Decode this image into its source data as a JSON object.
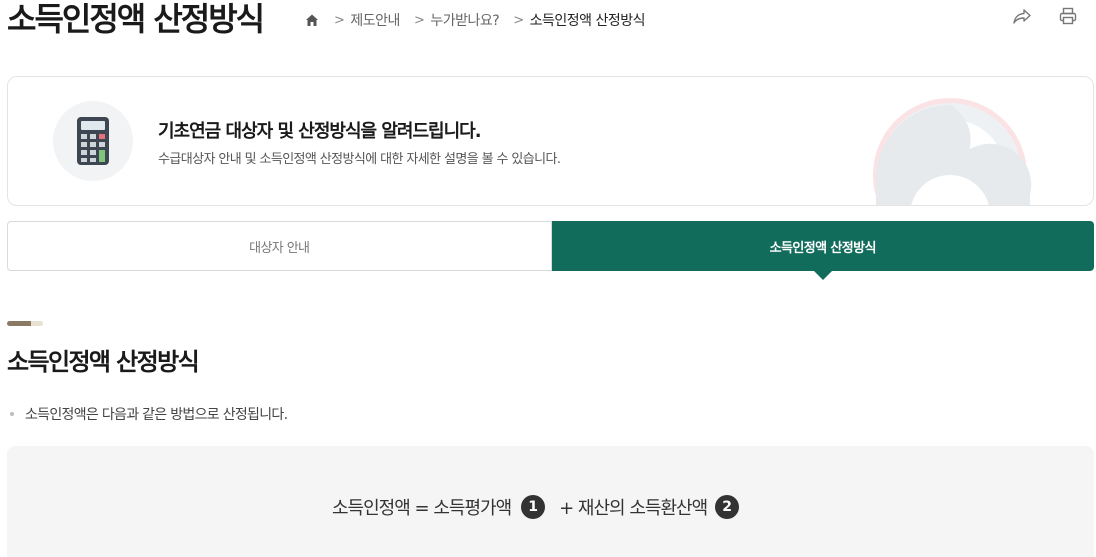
{
  "page_title": "소득인정액 산정방식",
  "breadcrumb": {
    "items": [
      "제도안내",
      "누가받나요?"
    ],
    "current": "소득인정액 산정방식"
  },
  "intro": {
    "title": "기초연금 대상자 및 산정방식을 알려드립니다.",
    "description": "수급대상자 안내 및 소득인정액 산정방식에 대한 자세한 설명을 볼 수 있습니다."
  },
  "tabs": [
    {
      "label": "대상자 안내",
      "active": false
    },
    {
      "label": "소득인정액 산정방식",
      "active": true
    }
  ],
  "section": {
    "title": "소득인정액 산정방식",
    "bullet": "소득인정액은 다음과 같은 방법으로 산정됩니다."
  },
  "formula": {
    "lhs": "소득인정액 = 소득평가액",
    "num1": "1",
    "plus_term": "+ 재산의 소득환산액",
    "num2": "2"
  },
  "icons": [
    "home-icon",
    "share-icon",
    "print-icon",
    "calculator-icon"
  ],
  "colors": {
    "accent": "#126c5b",
    "section_bar": "#8a7a63"
  }
}
